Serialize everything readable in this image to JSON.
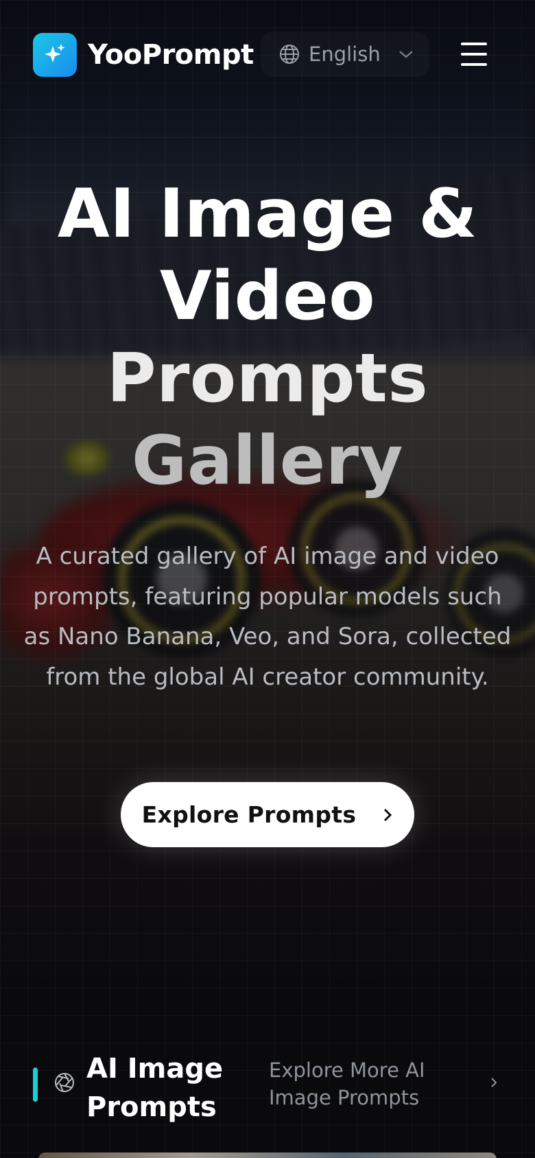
{
  "brand": {
    "name": "YooPrompt",
    "logo_icon": "sparkle-icon",
    "logo_gradient": [
      "#1cc7e6",
      "#1a8cf0"
    ]
  },
  "header": {
    "language": {
      "selected": "English",
      "icon": "globe-icon"
    },
    "menu_icon": "hamburger-menu-icon"
  },
  "hero": {
    "title_lines": [
      "AI Image &",
      "Video",
      "Prompts",
      "Gallery"
    ],
    "subtitle": "A curated gallery of AI image and video prompts, featuring popular models such as Nano Banana, Veo, and Sora, collected from the global AI creator community.",
    "cta_label": "Explore Prompts",
    "cta_icon": "chevron-right-icon"
  },
  "section": {
    "title": "AI Image Prompts",
    "icon": "aperture-icon",
    "accent_color": "#1ccdd8",
    "explore_more_label": "Explore More AI Image Prompts"
  }
}
